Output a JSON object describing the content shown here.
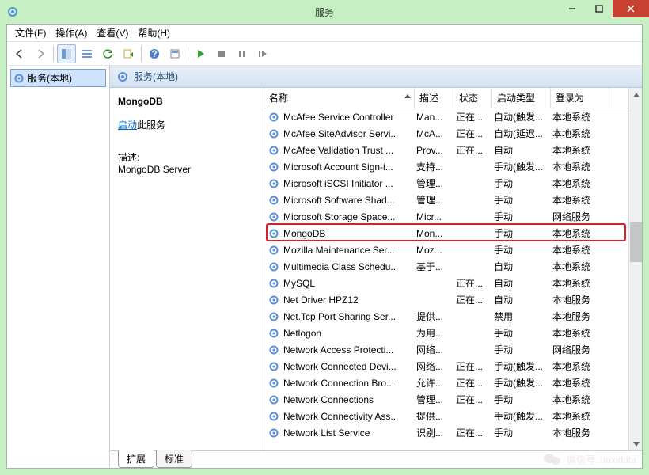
{
  "window": {
    "title": "服务"
  },
  "menu": {
    "file": "文件(F)",
    "action": "操作(A)",
    "view": "查看(V)",
    "help": "帮助(H)"
  },
  "tree": {
    "root": "服务(本地)"
  },
  "main": {
    "heading": "服务(本地)"
  },
  "detail": {
    "selected_name": "MongoDB",
    "start_link": "启动",
    "start_suffix": "此服务",
    "desc_label": "描述:",
    "desc_text": "MongoDB Server"
  },
  "columns": {
    "name": "名称",
    "desc": "描述",
    "status": "状态",
    "type": "启动类型",
    "logon": "登录为"
  },
  "rows": [
    {
      "name": "McAfee Service Controller",
      "desc": "Man...",
      "status": "正在...",
      "type": "自动(触发...",
      "logon": "本地系统"
    },
    {
      "name": "McAfee SiteAdvisor Servi...",
      "desc": "McA...",
      "status": "正在...",
      "type": "自动(延迟...",
      "logon": "本地系统"
    },
    {
      "name": "McAfee Validation Trust ...",
      "desc": "Prov...",
      "status": "正在...",
      "type": "自动",
      "logon": "本地系统"
    },
    {
      "name": "Microsoft Account Sign-i...",
      "desc": "支持...",
      "status": "",
      "type": "手动(触发...",
      "logon": "本地系统"
    },
    {
      "name": "Microsoft iSCSI Initiator ...",
      "desc": "管理...",
      "status": "",
      "type": "手动",
      "logon": "本地系统"
    },
    {
      "name": "Microsoft Software Shad...",
      "desc": "管理...",
      "status": "",
      "type": "手动",
      "logon": "本地系统"
    },
    {
      "name": "Microsoft Storage Space...",
      "desc": "Micr...",
      "status": "",
      "type": "手动",
      "logon": "网络服务"
    },
    {
      "name": "MongoDB",
      "desc": "Mon...",
      "status": "",
      "type": "手动",
      "logon": "本地系统",
      "hl": true
    },
    {
      "name": "Mozilla Maintenance Ser...",
      "desc": "Moz...",
      "status": "",
      "type": "手动",
      "logon": "本地系统"
    },
    {
      "name": "Multimedia Class Schedu...",
      "desc": "基于...",
      "status": "",
      "type": "自动",
      "logon": "本地系统"
    },
    {
      "name": "MySQL",
      "desc": "",
      "status": "正在...",
      "type": "自动",
      "logon": "本地系统"
    },
    {
      "name": "Net Driver HPZ12",
      "desc": "",
      "status": "正在...",
      "type": "自动",
      "logon": "本地服务"
    },
    {
      "name": "Net.Tcp Port Sharing Ser...",
      "desc": "提供...",
      "status": "",
      "type": "禁用",
      "logon": "本地服务"
    },
    {
      "name": "Netlogon",
      "desc": "为用...",
      "status": "",
      "type": "手动",
      "logon": "本地系统"
    },
    {
      "name": "Network Access Protecti...",
      "desc": "网络...",
      "status": "",
      "type": "手动",
      "logon": "网络服务"
    },
    {
      "name": "Network Connected Devi...",
      "desc": "网络...",
      "status": "正在...",
      "type": "手动(触发...",
      "logon": "本地系统"
    },
    {
      "name": "Network Connection Bro...",
      "desc": "允许...",
      "status": "正在...",
      "type": "手动(触发...",
      "logon": "本地系统"
    },
    {
      "name": "Network Connections",
      "desc": "管理...",
      "status": "正在...",
      "type": "手动",
      "logon": "本地系统"
    },
    {
      "name": "Network Connectivity Ass...",
      "desc": "提供...",
      "status": "",
      "type": "手动(触发...",
      "logon": "本地系统"
    },
    {
      "name": "Network List Service",
      "desc": "识别...",
      "status": "正在...",
      "type": "手动",
      "logon": "本地服务"
    }
  ],
  "tabs": {
    "ext": "扩展",
    "std": "标准"
  },
  "watermark": {
    "text": "微信号: haxidata"
  }
}
